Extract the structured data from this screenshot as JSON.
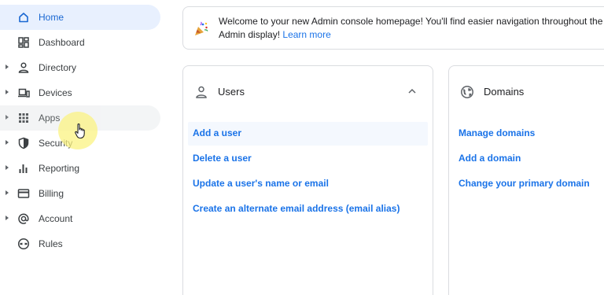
{
  "sidebar": {
    "items": [
      {
        "label": "Home",
        "icon": "home-icon",
        "active": true
      },
      {
        "label": "Dashboard",
        "icon": "dashboard-icon"
      },
      {
        "label": "Directory",
        "icon": "person-icon"
      },
      {
        "label": "Devices",
        "icon": "devices-icon"
      },
      {
        "label": "Apps",
        "icon": "apps-grid-icon"
      },
      {
        "label": "Security",
        "icon": "shield-icon"
      },
      {
        "label": "Reporting",
        "icon": "bar-chart-icon"
      },
      {
        "label": "Billing",
        "icon": "credit-card-icon"
      },
      {
        "label": "Account",
        "icon": "at-sign-icon"
      },
      {
        "label": "Rules",
        "icon": "rules-icon"
      }
    ]
  },
  "banner": {
    "text": "Welcome to your new Admin console homepage! You'll find easier navigation throughout the Admin display!",
    "link": "Learn more"
  },
  "users_card": {
    "title": "Users",
    "links": [
      "Add a user",
      "Delete a user",
      "Update a user's name or email",
      "Create an alternate email address (email alias)"
    ]
  },
  "domains_card": {
    "title": "Domains",
    "links": [
      "Manage domains",
      "Add a domain",
      "Change your primary domain"
    ]
  },
  "colors": {
    "accent": "#1a73e8",
    "active_bg": "#e8f0fe",
    "border": "#dadce0",
    "text": "#3c4043"
  }
}
